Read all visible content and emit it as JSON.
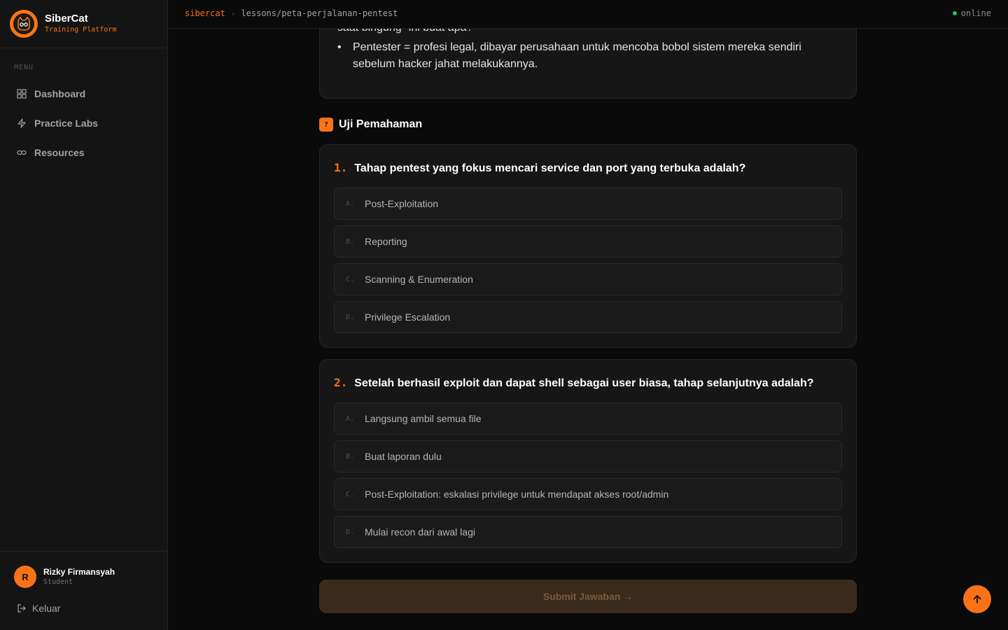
{
  "brand": {
    "name": "SiberCat",
    "subtitle": "Training Platform"
  },
  "sidebar": {
    "menu_heading": "MENU",
    "items": [
      {
        "label": "Dashboard",
        "icon": "grid-icon"
      },
      {
        "label": "Practice Labs",
        "icon": "bolt-icon"
      },
      {
        "label": "Resources",
        "icon": "link-icon"
      }
    ]
  },
  "user": {
    "initial": "R",
    "name": "Rizky Firmansyah",
    "role": "Student",
    "logout_label": "Keluar"
  },
  "topbar": {
    "root": "sibercat",
    "separator": "›",
    "path": "lessons/peta-perjalanan-pentest",
    "status": "online"
  },
  "content": {
    "partial_line": "saat bingung \"ini buat apa?\"",
    "bullet": "Pentester = profesi legal, dibayar perusahaan untuk mencoba bobol sistem mereka sendiri sebelum hacker jahat melakukannya."
  },
  "quiz": {
    "badge": "?",
    "title": "Uji Pemahaman",
    "questions": [
      {
        "number": "1.",
        "text": "Tahap pentest yang fokus mencari service dan port yang terbuka adalah?",
        "options": [
          {
            "letter": "A.",
            "text": "Post-Exploitation"
          },
          {
            "letter": "B.",
            "text": "Reporting"
          },
          {
            "letter": "C.",
            "text": "Scanning & Enumeration"
          },
          {
            "letter": "D.",
            "text": "Privilege Escalation"
          }
        ]
      },
      {
        "number": "2.",
        "text": "Setelah berhasil exploit dan dapat shell sebagai user biasa, tahap selanjutnya adalah?",
        "options": [
          {
            "letter": "A.",
            "text": "Langsung ambil semua file"
          },
          {
            "letter": "B.",
            "text": "Buat laporan dulu"
          },
          {
            "letter": "C.",
            "text": "Post-Exploitation: eskalasi privilege untuk mendapat akses root/admin"
          },
          {
            "letter": "D.",
            "text": "Mulai recon dari awal lagi"
          }
        ]
      }
    ],
    "submit_label": "Submit Jawaban →"
  },
  "colors": {
    "accent": "#f97316",
    "online": "#22c55e",
    "background": "#0a0a0a",
    "card": "#161616"
  }
}
